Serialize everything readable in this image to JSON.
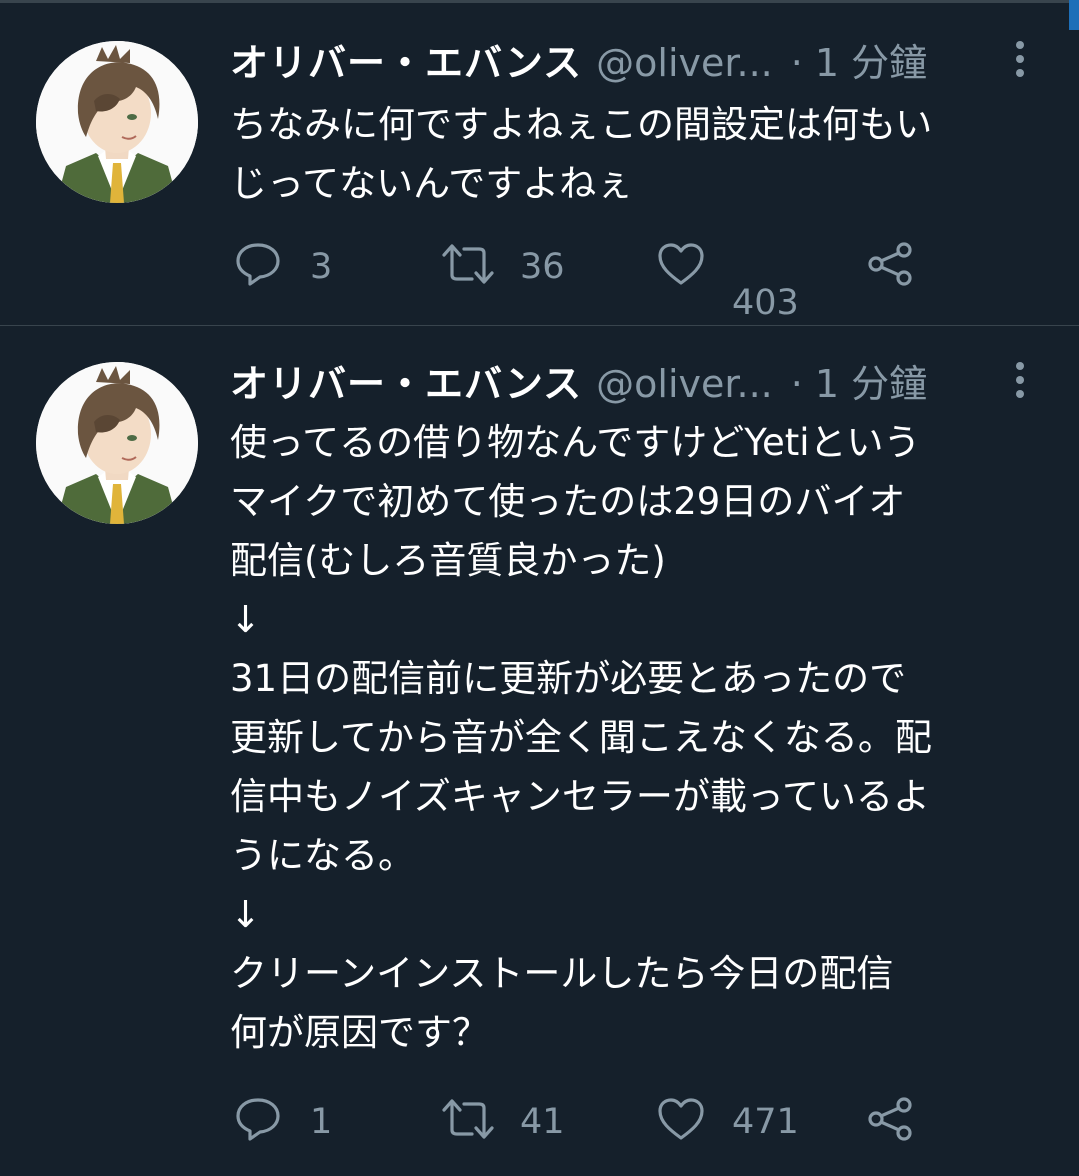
{
  "tweets": [
    {
      "display_name": "オリバー・エバンス",
      "handle": "@oliver...",
      "time_ago": "· 1 分鐘",
      "text": "ちなみに何ですよねぇこの間設定は何もい\nじってないんですよねぇ",
      "replies": "3",
      "retweets": "36",
      "likes": "403"
    },
    {
      "display_name": "オリバー・エバンス",
      "handle": "@oliver...",
      "time_ago": "· 1 分鐘",
      "text": "使ってるの借り物なんですけどYetiという\nマイクで初めて使ったのは29日のバイオ\n配信(むしろ音質良かった)\n↓\n31日の配信前に更新が必要とあったので\n更新してから音が全く聞こえなくなる。配\n信中もノイズキャンセラーが載っているよ\nうになる。\n↓\nクリーンインストールしたら今日の配信\n何が原因です？",
      "replies": "1",
      "retweets": "41",
      "likes": "471"
    }
  ],
  "icons": {
    "reply": "reply-icon",
    "retweet": "retweet-icon",
    "like": "heart-icon",
    "share": "share-icon",
    "more": "more-vertical-icon"
  },
  "colors": {
    "background": "#15202b",
    "text_primary": "#ffffff",
    "text_secondary": "#8899a6",
    "divider": "#38444d"
  }
}
